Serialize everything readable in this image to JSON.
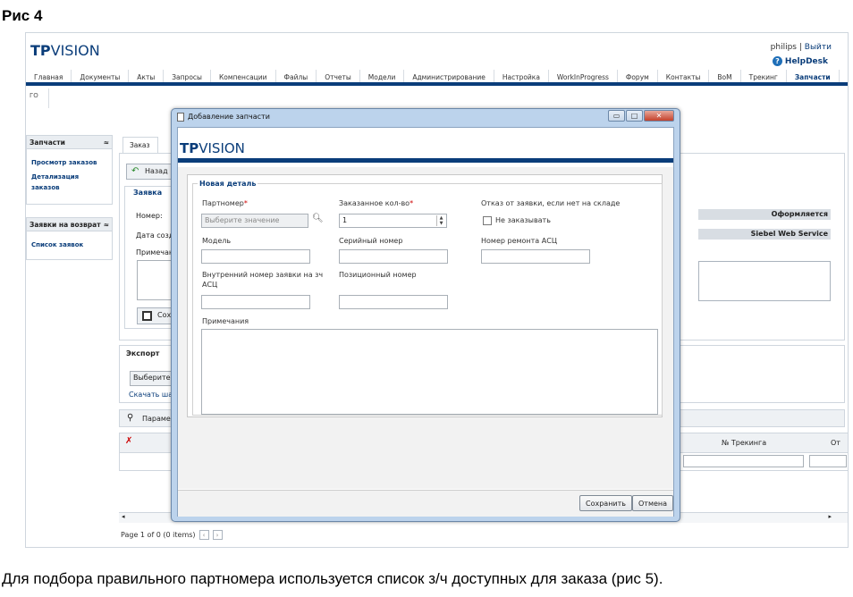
{
  "caption": "Рис 4",
  "bottom_text": "Для подбора правильного партномера используется список з/ч доступных для заказа  (рис 5).",
  "header": {
    "logo_bold": "TP",
    "logo_rest": "VISION",
    "user": "philips",
    "logout": "Выйти",
    "helpdesk": "HelpDesk"
  },
  "nav": [
    "Главная",
    "Документы",
    "Акты",
    "Запросы",
    "Компенсации",
    "Файлы",
    "Отчеты",
    "Модели",
    "Администрирование",
    "Настройка",
    "WorkInProgress",
    "Форум",
    "Контакты",
    "BoM",
    "Трекинг",
    "Запчасти"
  ],
  "subnav": "ГО",
  "sidebar": {
    "section1": {
      "title": "Запчасти",
      "links": [
        "Просмотр заказов",
        "Детализация заказов"
      ]
    },
    "section2": {
      "title": "Заявки на возврат",
      "links": [
        "Список заявок"
      ]
    }
  },
  "main": {
    "tab": "Заказ",
    "back": "Назад",
    "order_title": "Заявка",
    "number_label": "Номер:",
    "date_label": "Дата созд",
    "notes_label": "Примечан",
    "save": "Сох",
    "status1": "Оформляется",
    "status2": "Siebel Web Service",
    "export_title": "Экспорт",
    "export_select": "Выберите",
    "download": "Скачать ша",
    "params": "Параметр",
    "col_tracking": "№ Трекинга",
    "col_next": "От",
    "pager": "Page 1 of 0 (0 items)"
  },
  "dialog": {
    "title": "Добавление запчасти",
    "logo_bold": "TP",
    "logo_rest": "VISION",
    "legend": "Новая деталь",
    "partnumber_label": "Партномер",
    "partnumber_placeholder": "Выберите значение",
    "qty_label": "Заказанное кол-во",
    "qty_value": "1",
    "refuse_label": "Отказ от заявки, если нет на складе",
    "no_order_label": "Не заказывать",
    "model_label": "Модель",
    "serial_label": "Серийный номер",
    "repair_label": "Номер ремонта АСЦ",
    "internal_label": "Внутренний номер заявки на зч АСЦ",
    "position_label": "Позиционный номер",
    "notes_label": "Примечания",
    "save": "Сохранить",
    "cancel": "Отмена"
  }
}
